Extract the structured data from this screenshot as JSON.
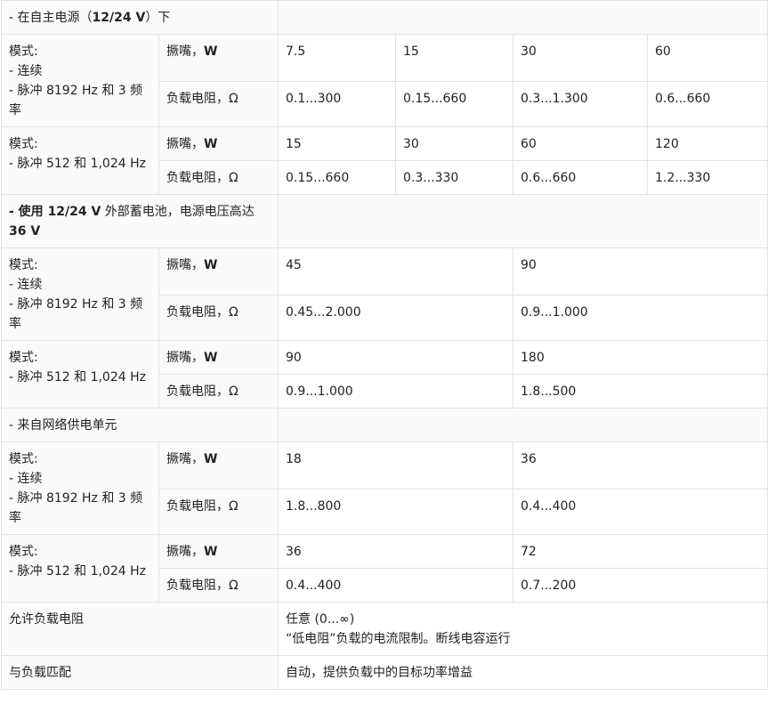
{
  "mode_label": "模式:",
  "mode_continuous": "- 连续",
  "mode_pulse_8192": "- 脉冲 8192 Hz 和 3 频率",
  "mode_pulse_512": "- 脉冲 512 和 1,024 Hz",
  "param_power": "撅嘴，",
  "unit_w": "W",
  "param_resistance": "负载电阻，Ω",
  "sections": [
    {
      "title_pre": "- 在自主电源（",
      "title_bold": "12/24 V",
      "title_post": "）下",
      "title_bold2": "",
      "groups": [
        {
          "power": [
            "7.5",
            "15",
            "30",
            "60"
          ],
          "resistance": [
            "0.1...300",
            "0.15...660",
            "0.3...1.300",
            "0.6...660"
          ]
        },
        {
          "power": [
            "15",
            "30",
            "60",
            "120"
          ],
          "resistance": [
            "0.15...660",
            "0.3...330",
            "0.6...660",
            "1.2...330"
          ]
        }
      ]
    },
    {
      "title_pre": "- 使用 ",
      "title_bold": "12/24 V",
      "title_post": " 外部蓄电池，电源电压高达 ",
      "title_bold2": "36 V",
      "groups": [
        {
          "power": [
            "45",
            "90"
          ],
          "resistance": [
            "0.45...2.000",
            "0.9...1.000"
          ]
        },
        {
          "power": [
            "90",
            "180"
          ],
          "resistance": [
            "0.9...1.000",
            "1.8...500"
          ]
        }
      ]
    },
    {
      "title_pre": "- 来自网络供电单元",
      "title_bold": "",
      "title_post": "",
      "title_bold2": "",
      "groups": [
        {
          "power": [
            "18",
            "36"
          ],
          "resistance": [
            "1.8...800",
            "0.4...400"
          ]
        },
        {
          "power": [
            "36",
            "72"
          ],
          "resistance": [
            "0.4...400",
            "0.7...200"
          ]
        }
      ]
    }
  ],
  "allowed_load": {
    "label": "允许负载电阻",
    "line1": "任意 (0...∞)",
    "line2": "“低电阻”负载的电流限制。断线电容运行"
  },
  "matching": {
    "label": "与负载匹配",
    "value": "自动，提供负载中的目标功率增益"
  }
}
